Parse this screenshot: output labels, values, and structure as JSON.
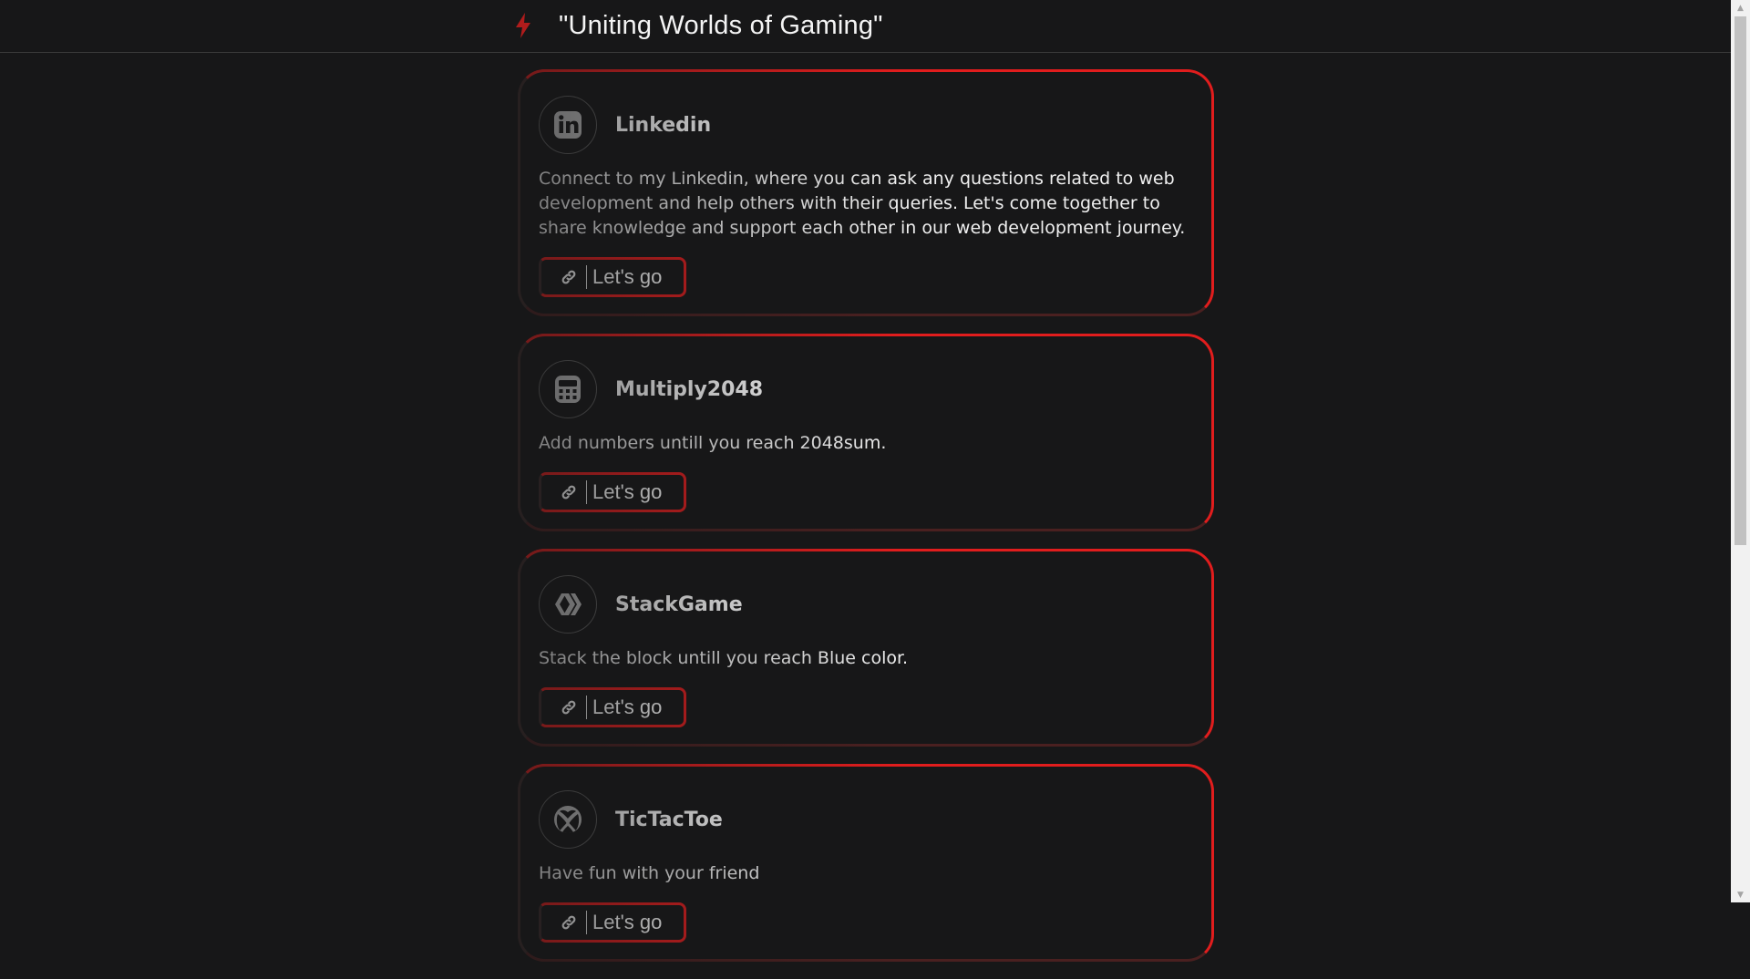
{
  "header": {
    "title": "\"Uniting Worlds of Gaming\"",
    "icon": "lightning-bolt-icon",
    "accent": "#b01c1c"
  },
  "cards": [
    {
      "title": "Linkedin",
      "icon": "linkedin-icon",
      "description": "Connect to my Linkedin, where you can ask any questions related to web development and help others with their queries. Let's come together to share knowledge and support each other in our web development journey.",
      "button_label": "Let's go"
    },
    {
      "title": "Multiply2048",
      "icon": "calculator-icon",
      "description": "Add numbers untill you reach 2048sum.",
      "button_label": "Let's go"
    },
    {
      "title": "StackGame",
      "icon": "hive-icon",
      "description": "Stack the block untill you reach Blue color.",
      "button_label": "Let's go"
    },
    {
      "title": "TicTacToe",
      "icon": "xbox-icon",
      "description": "Have fun with your friend",
      "button_label": "Let's go"
    }
  ],
  "colors": {
    "background": "#171718",
    "accent_red": "#e11d1d",
    "text": "#ffffff"
  }
}
